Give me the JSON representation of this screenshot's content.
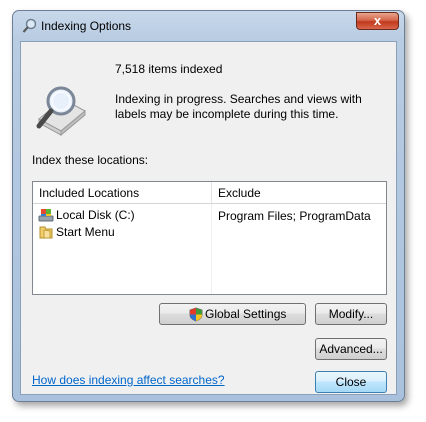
{
  "window": {
    "title": "Indexing Options",
    "close_label": "x"
  },
  "status": {
    "count": "7,518 items indexed",
    "message": "Indexing in progress. Searches and views with labels may be incomplete during this time."
  },
  "index_label": "Index these locations:",
  "table": {
    "headers": {
      "included": "Included Locations",
      "exclude": "Exclude"
    },
    "rows": [
      {
        "location": "Local Disk (C:)",
        "icon": "drive-icon",
        "exclude": "Program Files; ProgramData"
      },
      {
        "location": "Start Menu",
        "icon": "folder-icon",
        "exclude": ""
      }
    ]
  },
  "buttons": {
    "global_settings": "Global Settings",
    "modify": "Modify...",
    "advanced": "Advanced...",
    "close": "Close"
  },
  "help_link": "How does indexing affect searches?",
  "colors": {
    "link": "#0066cc",
    "close_accent": "#c1391d",
    "default_button": "#3c7fb1"
  }
}
